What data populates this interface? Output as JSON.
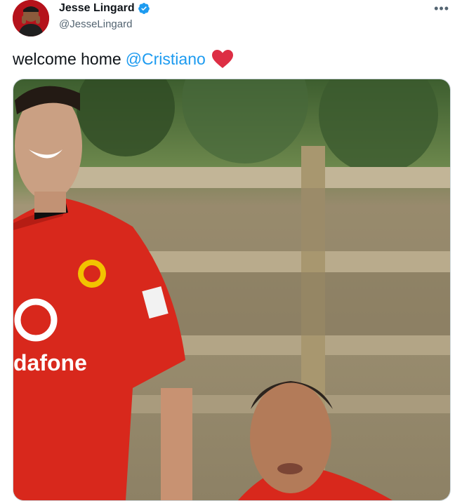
{
  "author": {
    "display_name": "Jesse Lingard",
    "handle": "@JesseLingard",
    "verified_icon": "verified-badge-icon",
    "avatar_icon": "avatar"
  },
  "more_menu": {
    "label": "•••",
    "icon": "more-options-icon"
  },
  "tweet": {
    "text": "welcome home",
    "mention": "@Cristiano",
    "emoji_icon": "red-heart-icon"
  },
  "media": {
    "type": "video-still",
    "shirt_logo_text": "dafone",
    "colors": {
      "shirt": "#d8281c",
      "foliage": "#3a5a2c",
      "fence": "#b7a88a"
    }
  },
  "colors": {
    "accent": "#1d9bf0",
    "verified": "#1d9bf0",
    "heart": "#e0245e"
  }
}
